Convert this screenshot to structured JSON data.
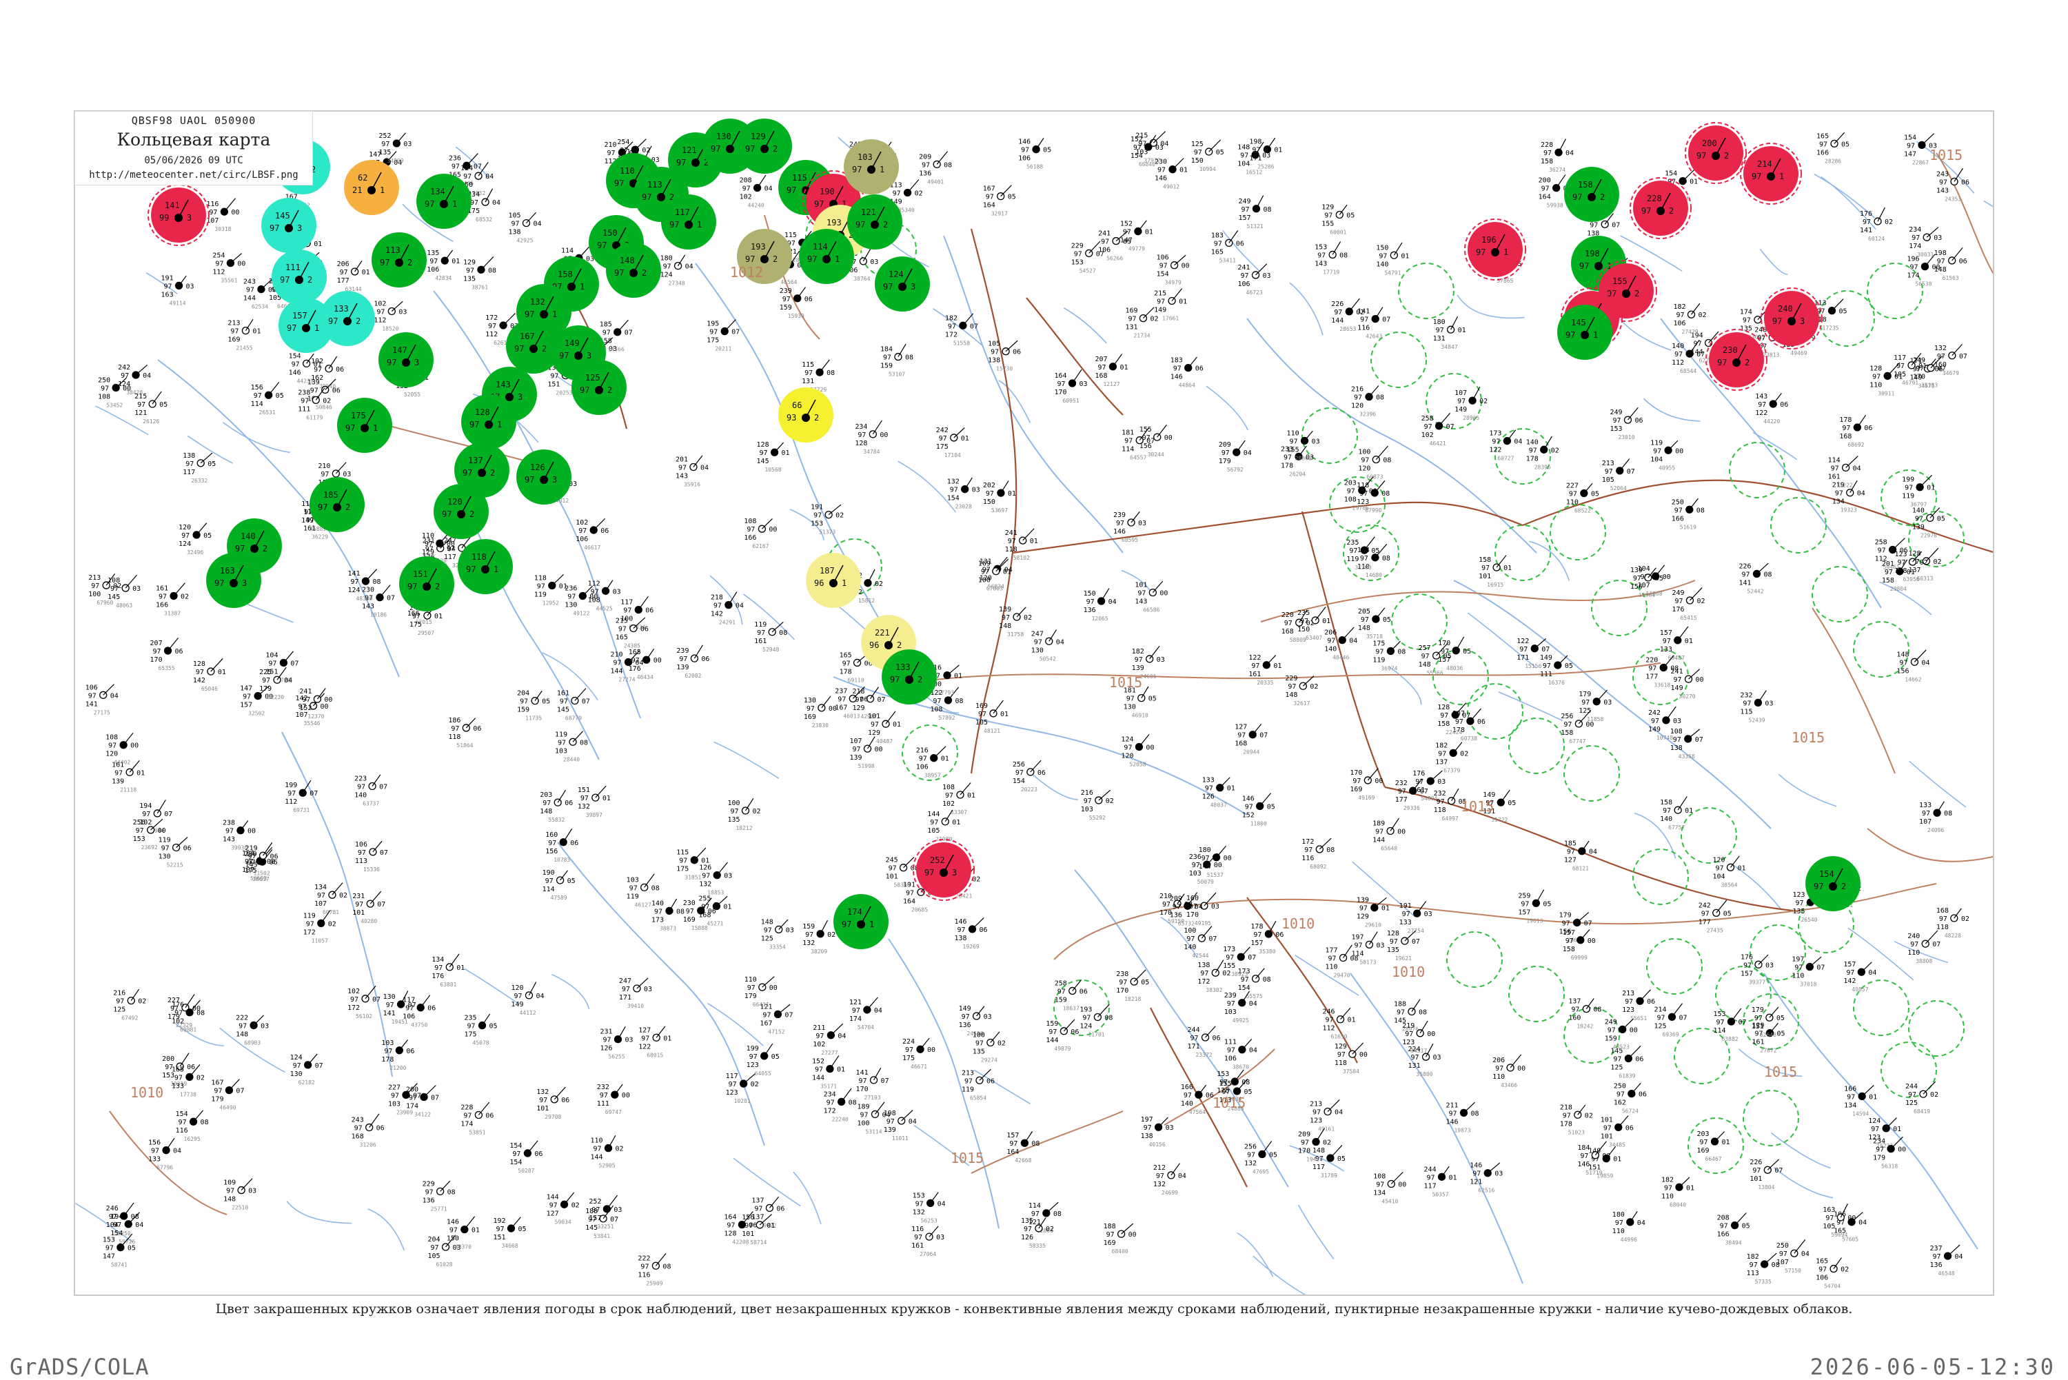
{
  "header": {
    "code_line": "QBSF98  UAOL  050900",
    "title": "Кольцевая карта",
    "datetime": "05/06/2026 09 UTC",
    "url": "http://meteocenter.net/circ/LBSF.png"
  },
  "legend_text": "Цвет закрашенных кружков означает явления погоды в срок наблюдений, цвет незакрашенных кружков - конвективные явления между сроками наблюдений, пунктирные незакрашенные кружки - наличие кучево-дождевых облаков.",
  "footer": {
    "software": "GrADS/COLA",
    "timestamp": "2026-06-05-12:30"
  },
  "isobar_labels": [
    "1015",
    "1015",
    "1010",
    "1015",
    "1015",
    "1010",
    "1010",
    "1015",
    "1015",
    "1012",
    "1015"
  ],
  "colors": {
    "green": "#00b020",
    "red": "#e8254a",
    "cyan": "#2de8c8",
    "orange": "#f5b040",
    "yellow": "#f5f030",
    "pale_yellow": "#f5ee90",
    "olive": "#b0b070",
    "ring": "#30c040",
    "river": "#8fb8e8",
    "border": "#a05030",
    "isobar": "#c08060"
  },
  "stations": [
    {
      "id": "s1",
      "kind": "red",
      "p": "141",
      "t": "99",
      "w": "3"
    },
    {
      "id": "s2",
      "kind": "cyan",
      "p": "123",
      "t": "97",
      "w": "2"
    },
    {
      "id": "s3",
      "kind": "orange",
      "p": "62",
      "t": "21",
      "w": "1"
    },
    {
      "id": "s4",
      "kind": "cyan",
      "p": "145",
      "t": "97",
      "w": "3"
    },
    {
      "id": "s5",
      "kind": "cyan",
      "p": "111",
      "t": "97",
      "w": "2"
    },
    {
      "id": "s6",
      "kind": "cyan",
      "p": "157",
      "t": "97",
      "w": "1"
    },
    {
      "id": "s7",
      "kind": "cyan",
      "p": "133",
      "t": "97",
      "w": "2"
    },
    {
      "id": "s8",
      "kind": "green",
      "p": "113",
      "t": "97",
      "w": "2"
    },
    {
      "id": "s9",
      "kind": "green",
      "p": "134",
      "t": "97",
      "w": "1"
    },
    {
      "id": "s10",
      "kind": "green",
      "p": "150",
      "t": "97",
      "w": "3"
    },
    {
      "id": "s11",
      "kind": "green",
      "p": "148",
      "t": "97",
      "w": "2"
    },
    {
      "id": "s12",
      "kind": "green",
      "p": "158",
      "t": "97",
      "w": "1"
    },
    {
      "id": "s13",
      "kind": "green",
      "p": "149",
      "t": "97",
      "w": "3"
    },
    {
      "id": "s14",
      "kind": "green",
      "p": "125",
      "t": "97",
      "w": "2"
    },
    {
      "id": "s15",
      "kind": "green",
      "p": "132",
      "t": "97",
      "w": "1"
    },
    {
      "id": "s16",
      "kind": "green",
      "p": "167",
      "t": "97",
      "w": "2"
    },
    {
      "id": "s17",
      "kind": "green",
      "p": "143",
      "t": "97",
      "w": "3"
    },
    {
      "id": "s18",
      "kind": "green",
      "p": "128",
      "t": "97",
      "w": "1"
    },
    {
      "id": "s19",
      "kind": "green",
      "p": "137",
      "t": "97",
      "w": "2"
    },
    {
      "id": "s20",
      "kind": "green",
      "p": "120",
      "t": "97",
      "w": "2"
    },
    {
      "id": "s21",
      "kind": "green",
      "p": "126",
      "t": "97",
      "w": "3"
    },
    {
      "id": "s22",
      "kind": "green",
      "p": "118",
      "t": "97",
      "w": "1"
    },
    {
      "id": "s23",
      "kind": "green",
      "p": "151",
      "t": "97",
      "w": "2"
    },
    {
      "id": "s24",
      "kind": "green",
      "p": "147",
      "t": "97",
      "w": "3"
    },
    {
      "id": "s25",
      "kind": "green",
      "p": "175",
      "t": "97",
      "w": "1"
    },
    {
      "id": "s26",
      "kind": "green",
      "p": "185",
      "t": "97",
      "w": "2"
    },
    {
      "id": "s27",
      "kind": "green",
      "p": "140",
      "t": "97",
      "w": "2"
    },
    {
      "id": "s28",
      "kind": "green",
      "p": "163",
      "t": "97",
      "w": "3"
    },
    {
      "id": "s29",
      "kind": "green",
      "p": "110",
      "t": "97",
      "w": "1"
    },
    {
      "id": "s30",
      "kind": "green",
      "p": "113",
      "t": "97",
      "w": "2"
    },
    {
      "id": "s31",
      "kind": "green",
      "p": "121",
      "t": "97",
      "w": "2"
    },
    {
      "id": "s32",
      "kind": "green",
      "p": "117",
      "t": "97",
      "w": "1"
    },
    {
      "id": "s33",
      "kind": "green",
      "p": "130",
      "t": "97",
      "w": "3"
    },
    {
      "id": "s34",
      "kind": "green",
      "p": "129",
      "t": "97",
      "w": "2"
    },
    {
      "id": "s35",
      "kind": "green",
      "p": "115",
      "t": "97",
      "w": "2"
    },
    {
      "id": "s36",
      "kind": "red",
      "p": "190",
      "t": "97",
      "w": "1"
    },
    {
      "id": "s37",
      "kind": "olive",
      "p": "193",
      "t": "97",
      "w": "2"
    },
    {
      "id": "s38",
      "kind": "olive",
      "p": "103",
      "t": "97",
      "w": "1"
    },
    {
      "id": "s39",
      "kind": "pale_yellow",
      "p": "193",
      "t": "96",
      "w": "2"
    },
    {
      "id": "s40",
      "kind": "green",
      "p": "114",
      "t": "97",
      "w": "1"
    },
    {
      "id": "s41",
      "kind": "green",
      "p": "121",
      "t": "97",
      "w": "2"
    },
    {
      "id": "s42",
      "kind": "green",
      "p": "124",
      "t": "97",
      "w": "3"
    },
    {
      "id": "s43",
      "kind": "yellow",
      "p": "66",
      "t": "93",
      "w": "2"
    },
    {
      "id": "s44",
      "kind": "pale_yellow",
      "p": "187",
      "t": "96",
      "w": "1"
    },
    {
      "id": "s45",
      "kind": "pale_yellow",
      "p": "221",
      "t": "96",
      "w": "2"
    },
    {
      "id": "s46",
      "kind": "green",
      "p": "133",
      "t": "97",
      "w": "2"
    },
    {
      "id": "s47",
      "kind": "red",
      "p": "252",
      "t": "97",
      "w": "3"
    },
    {
      "id": "s48",
      "kind": "green",
      "p": "174",
      "t": "97",
      "w": "1"
    },
    {
      "id": "s49",
      "kind": "green",
      "p": "158",
      "t": "97",
      "w": "2"
    },
    {
      "id": "s50",
      "kind": "green",
      "p": "198",
      "t": "97",
      "w": "1"
    },
    {
      "id": "s51",
      "kind": "red",
      "p": "155",
      "t": "97",
      "w": "2"
    },
    {
      "id": "s52",
      "kind": "red",
      "p": "196",
      "t": "97",
      "w": "1"
    },
    {
      "id": "s53",
      "kind": "red",
      "p": "206",
      "t": "97",
      "w": "3"
    },
    {
      "id": "s54",
      "kind": "red",
      "p": "200",
      "t": "97",
      "w": "2"
    },
    {
      "id": "s55",
      "kind": "red",
      "p": "214",
      "t": "97",
      "w": "1"
    },
    {
      "id": "s56",
      "kind": "red",
      "p": "228",
      "t": "97",
      "w": "2"
    },
    {
      "id": "s57",
      "kind": "red",
      "p": "240",
      "t": "97",
      "w": "3"
    },
    {
      "id": "s58",
      "kind": "red",
      "p": "230",
      "t": "97",
      "w": "2"
    },
    {
      "id": "s59",
      "kind": "green",
      "p": "145",
      "t": "97",
      "w": "1"
    },
    {
      "id": "s60",
      "kind": "green",
      "p": "154",
      "t": "97",
      "w": "2"
    }
  ]
}
